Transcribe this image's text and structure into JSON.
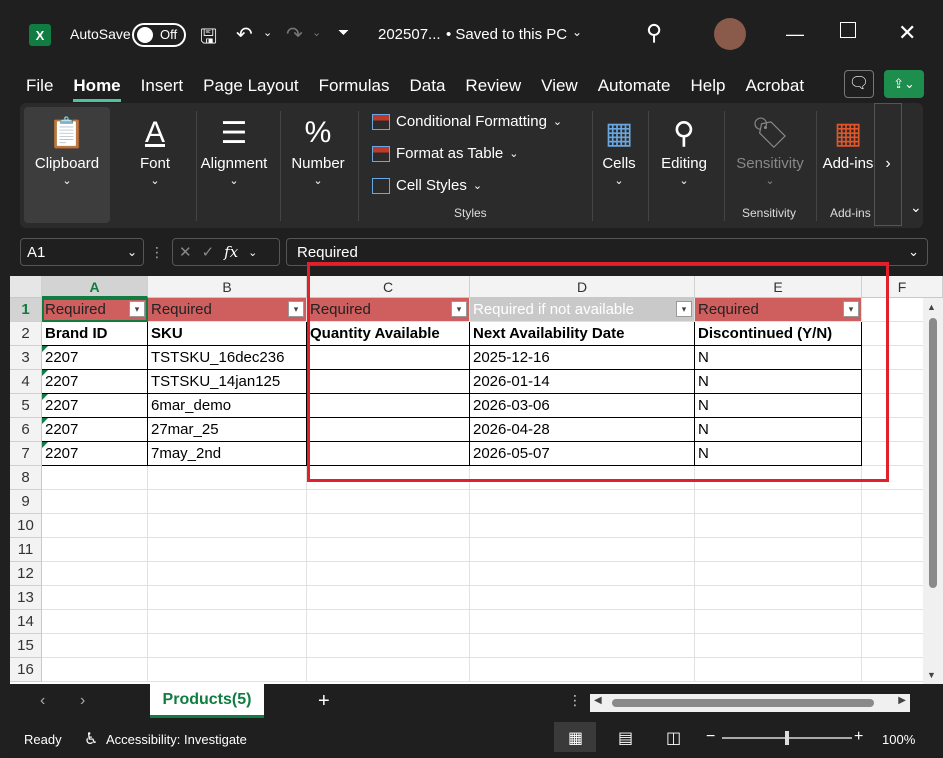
{
  "titlebar": {
    "app_icon": "X",
    "autosave_label": "AutoSave",
    "autosave_state": "Off",
    "filename": "202507...",
    "save_status": "• Saved to this PC"
  },
  "menu": [
    "File",
    "Home",
    "Insert",
    "Page Layout",
    "Formulas",
    "Data",
    "Review",
    "View",
    "Automate",
    "Help",
    "Acrobat"
  ],
  "ribbon": {
    "clipboard": "Clipboard",
    "font": "Font",
    "alignment": "Alignment",
    "number": "Number",
    "conditional_formatting": "Conditional Formatting",
    "format_as_table": "Format as Table",
    "cell_styles": "Cell Styles",
    "styles_group": "Styles",
    "cells": "Cells",
    "editing": "Editing",
    "sensitivity": "Sensitivity",
    "sensitivity_group": "Sensitivity",
    "addins": "Add-ins",
    "addins_group": "Add-ins"
  },
  "formula_bar": {
    "name_box": "A1",
    "fx": "fx",
    "value": "Required"
  },
  "columns": [
    "A",
    "B",
    "C",
    "D",
    "E",
    "F"
  ],
  "rows": [
    "1",
    "2",
    "3",
    "4",
    "5",
    "6",
    "7",
    "8",
    "9",
    "10",
    "11",
    "12",
    "13",
    "14",
    "15",
    "16"
  ],
  "sheet": {
    "row1": [
      "Required",
      "Required",
      "Required",
      "Required if not available",
      "Required"
    ],
    "row2": [
      "Brand ID",
      "SKU",
      "Quantity Available",
      "Next Availability Date",
      "Discontinued (Y/N)"
    ],
    "data": [
      [
        "2207",
        "TSTSKU_16dec236",
        "",
        "2025-12-16",
        "N"
      ],
      [
        "2207",
        "TSTSKU_14jan125",
        "",
        "2026-01-14",
        "N"
      ],
      [
        "2207",
        "6mar_demo",
        "",
        "2026-03-06",
        "N"
      ],
      [
        "2207",
        "27mar_25",
        "",
        "2026-04-28",
        "N"
      ],
      [
        "2207",
        "7may_2nd",
        "",
        "2026-05-07",
        "N"
      ]
    ]
  },
  "tabs": {
    "active": "Products(5)",
    "add": "+"
  },
  "status": {
    "ready": "Ready",
    "accessibility": "Accessibility: Investigate",
    "zoom": "100%"
  }
}
